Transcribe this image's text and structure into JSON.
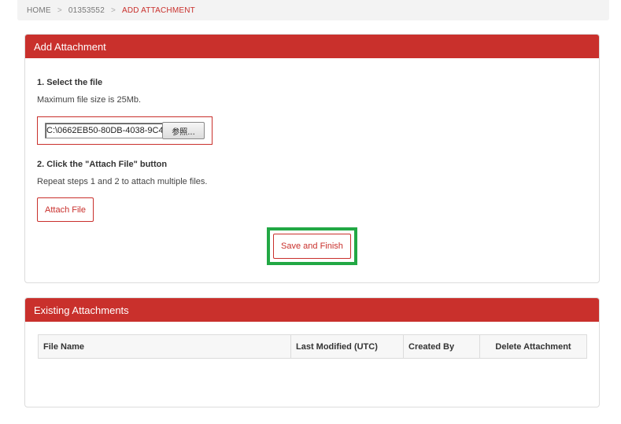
{
  "breadcrumb": {
    "home": "HOME",
    "separator": ">",
    "record": "01353552",
    "current": "ADD ATTACHMENT"
  },
  "add_panel": {
    "title": "Add Attachment",
    "step1_title": "1. Select the file",
    "step1_desc": "Maximum file size is 25Mb.",
    "file_value": "C:\\0662EB50-80DB-4038-9C4",
    "browse_label": "参照...",
    "step2_title": "2. Click the \"Attach File\" button",
    "step2_desc": "Repeat steps 1 and 2 to attach multiple files.",
    "attach_label": "Attach File",
    "save_label": "Save and Finish"
  },
  "existing_panel": {
    "title": "Existing Attachments",
    "columns": [
      "File Name",
      "Last Modified (UTC)",
      "Created By",
      "Delete Attachment"
    ]
  },
  "colors": {
    "accent": "#c9302c",
    "highlight": "#22a844"
  }
}
